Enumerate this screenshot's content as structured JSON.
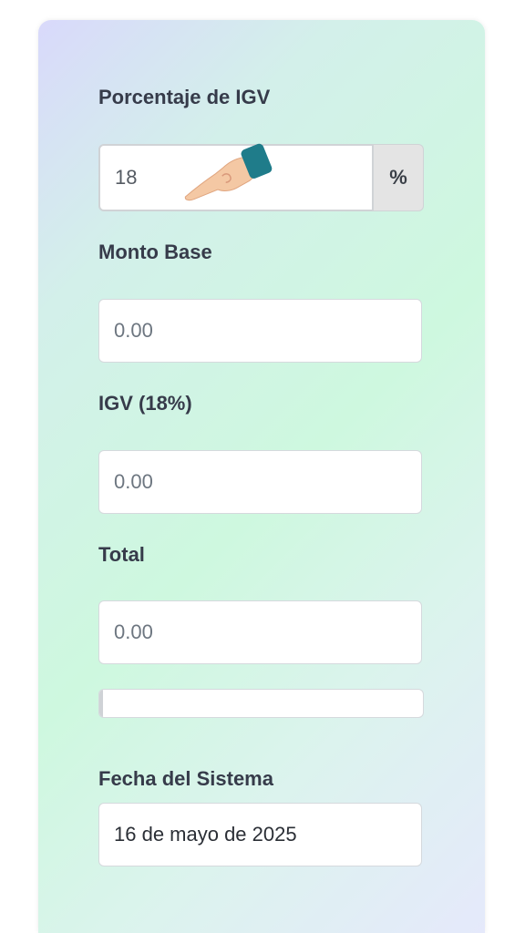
{
  "igv": {
    "label": "Porcentaje de IGV",
    "value": "18",
    "unit": "%"
  },
  "monto_base": {
    "label": "Monto Base",
    "placeholder": "0.00"
  },
  "igv_monto": {
    "label": "IGV (18%)",
    "placeholder": "0.00"
  },
  "total": {
    "label": "Total",
    "placeholder": "0.00",
    "progress_percent": 1
  },
  "fecha": {
    "label": "Fecha del Sistema",
    "value": "16 de mayo de 2025"
  },
  "colors": {
    "label_text": "#363b4a",
    "hand_cuff": "#1f7c8a",
    "hand_skin": "#f4c8a4"
  }
}
